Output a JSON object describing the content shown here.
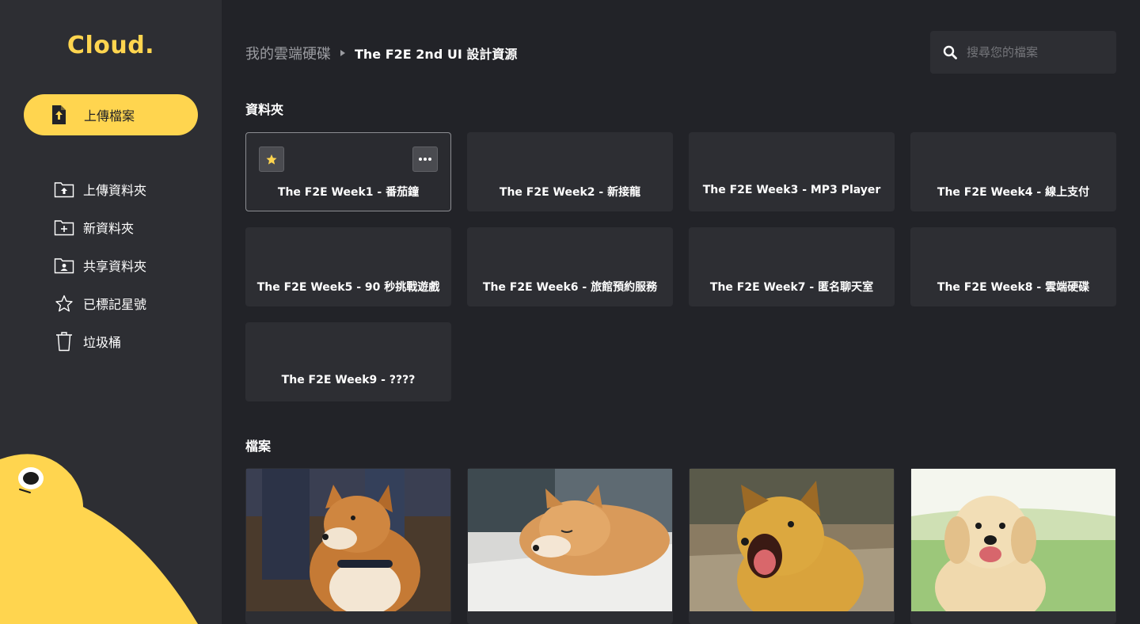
{
  "app": {
    "logo": "Cloud."
  },
  "sidebar": {
    "upload_label": "上傳檔案",
    "items": [
      {
        "label": "上傳資料夾",
        "icon": "folder-upload-icon"
      },
      {
        "label": "新資料夾",
        "icon": "folder-add-icon"
      },
      {
        "label": "共享資料夾",
        "icon": "folder-shared-icon"
      },
      {
        "label": "已標記星號",
        "icon": "star-outline-icon"
      },
      {
        "label": "垃圾桶",
        "icon": "trash-icon"
      }
    ]
  },
  "header": {
    "breadcrumb_root": "我的雲端硬碟",
    "breadcrumb_current": "The F2E 2nd UI 設計資源",
    "search_placeholder": "搜尋您的檔案"
  },
  "sections": {
    "folders_title": "資料夾",
    "files_title": "檔案"
  },
  "folders": [
    {
      "name": "The F2E Week1 - 番茄鐘",
      "selected": true,
      "starred": true
    },
    {
      "name": "The F2E Week2 - 新接龍"
    },
    {
      "name": "The F2E Week3 - MP3 Player"
    },
    {
      "name": "The F2E Week4 - 線上支付"
    },
    {
      "name": "The F2E Week5 - 90 秒挑戰遊戲"
    },
    {
      "name": "The F2E Week6 - 旅館預約服務"
    },
    {
      "name": "The F2E Week7 - 匿名聊天室"
    },
    {
      "name": "The F2E Week8 - 雲端硬碟"
    },
    {
      "name": "The F2E Week9 - ????"
    }
  ],
  "files": [
    {
      "thumbnail": "shiba-inu-photo"
    },
    {
      "thumbnail": "sleeping-shiba-photo"
    },
    {
      "thumbnail": "yawning-dog-photo"
    },
    {
      "thumbnail": "golden-retriever-photo"
    }
  ],
  "colors": {
    "accent": "#ffd54f",
    "background": "#222328",
    "panel": "#2d2e33"
  }
}
